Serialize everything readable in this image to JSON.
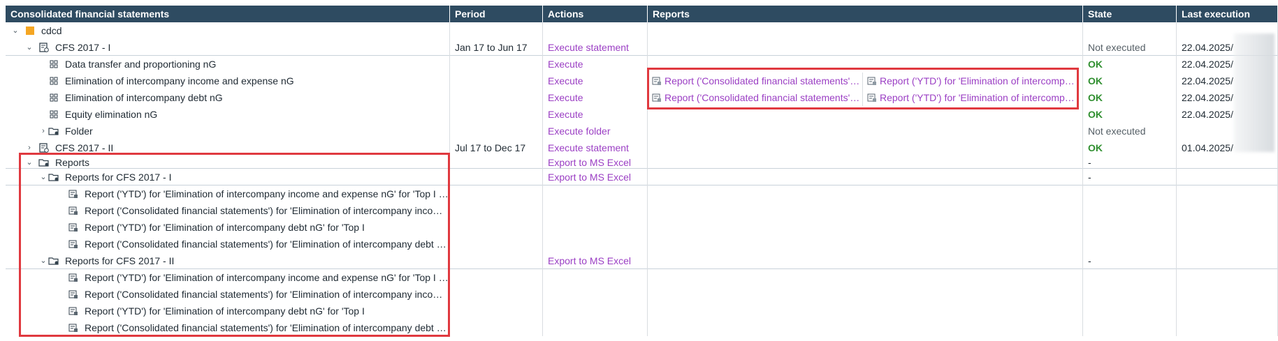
{
  "headers": {
    "name": "Consolidated financial statements",
    "period": "Period",
    "actions": "Actions",
    "reports": "Reports",
    "state": "State",
    "last_execution": "Last execution"
  },
  "rows": [
    {
      "name": "cdcd",
      "period": "",
      "action": "",
      "state": "",
      "last": ""
    },
    {
      "name": "CFS 2017 - I",
      "period": "Jan 17 to Jun 17",
      "action": "Execute statement",
      "state": "Not executed",
      "last": "22.04.2025/"
    },
    {
      "name": "Data transfer and proportioning nG",
      "period": "",
      "action": "Execute",
      "state": "OK",
      "last": "22.04.2025/"
    },
    {
      "name": "Elimination of intercompany income and expense nG",
      "period": "",
      "action": "Execute",
      "state": "OK",
      "last": "22.04.2025/",
      "report_a": "Report ('Consolidated financial statements') for 'Elimination of intercompany income and expense nG'",
      "report_b": "Report ('YTD') for 'Elimination of intercompany income and expense nG'"
    },
    {
      "name": "Elimination of intercompany debt nG",
      "period": "",
      "action": "Execute",
      "state": "OK",
      "last": "22.04.2025/",
      "report_a": "Report ('Consolidated financial statements') for 'Elimination of intercompany debt nG'",
      "report_b": "Report ('YTD') for 'Elimination of intercompany debt nG'"
    },
    {
      "name": "Equity elimination nG",
      "period": "",
      "action": "Execute",
      "state": "OK",
      "last": "22.04.2025/"
    },
    {
      "name": "Folder",
      "period": "",
      "action": "Execute folder",
      "state": "Not executed",
      "last": ""
    },
    {
      "name": "CFS 2017 - II",
      "period": "Jul 17 to Dec 17",
      "action": "Execute statement",
      "state": "OK",
      "last": "01.04.2025/"
    },
    {
      "name": "Reports",
      "period": "",
      "action": "Export to MS Excel",
      "state": "-",
      "last": ""
    },
    {
      "name": "Reports for CFS 2017 - I",
      "period": "",
      "action": "Export to MS Excel",
      "state": "-",
      "last": ""
    },
    {
      "name": "Report ('YTD') for 'Elimination of intercompany income and expense nG' for 'Top I Group'"
    },
    {
      "name": "Report ('Consolidated financial statements') for 'Elimination of intercompany income and expense nG'"
    },
    {
      "name": "Report ('YTD') for 'Elimination of intercompany debt nG' for 'Top I"
    },
    {
      "name": "Report ('Consolidated financial statements') for 'Elimination of intercompany debt nG'"
    },
    {
      "name": "Reports for CFS 2017 - II",
      "period": "",
      "action": "Export to MS Excel",
      "state": "-",
      "last": ""
    },
    {
      "name": "Report ('YTD') for 'Elimination of intercompany income and expense nG' for 'Top I Group'"
    },
    {
      "name": "Report ('Consolidated financial statements') for 'Elimination of intercompany income and expense nG'"
    },
    {
      "name": "Report ('YTD') for 'Elimination of intercompany debt nG' for 'Top I"
    },
    {
      "name": "Report ('Consolidated financial statements') for 'Elimination of intercompany debt nG'"
    }
  ],
  "colors": {
    "header_bg": "#2e4b61",
    "link": "#9b3fc4",
    "ok": "#2f8f2f",
    "highlight": "#e0393f",
    "company_square": "#f5a623"
  }
}
